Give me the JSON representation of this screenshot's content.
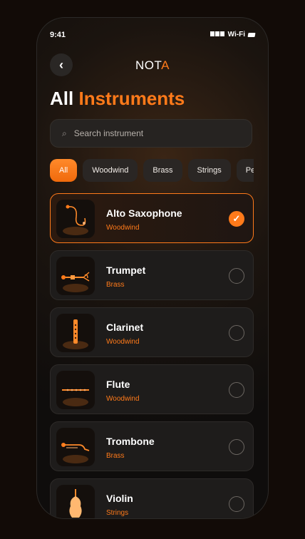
{
  "status": {
    "time": "9:41",
    "network": "Wi-Fi"
  },
  "header": {
    "logo_main": "NOT",
    "logo_accent": "A"
  },
  "page": {
    "title_white": "All",
    "title_accent": "Instruments"
  },
  "search": {
    "placeholder": "Search instrument"
  },
  "filters": [
    {
      "label": "All",
      "active": true
    },
    {
      "label": "Woodwind",
      "active": false
    },
    {
      "label": "Brass",
      "active": false
    },
    {
      "label": "Strings",
      "active": false
    },
    {
      "label": "Pe",
      "active": false
    }
  ],
  "instruments": [
    {
      "name": "Alto Saxophone",
      "category": "Woodwind",
      "selected": true,
      "icon": "saxophone-icon"
    },
    {
      "name": "Trumpet",
      "category": "Brass",
      "selected": false,
      "icon": "trumpet-icon"
    },
    {
      "name": "Clarinet",
      "category": "Woodwind",
      "selected": false,
      "icon": "clarinet-icon"
    },
    {
      "name": "Flute",
      "category": "Woodwind",
      "selected": false,
      "icon": "flute-icon"
    },
    {
      "name": "Trombone",
      "category": "Brass",
      "selected": false,
      "icon": "trombone-icon"
    },
    {
      "name": "Violin",
      "category": "Strings",
      "selected": false,
      "icon": "violin-icon"
    }
  ],
  "colors": {
    "accent": "#ff7a1a",
    "background": "#120b07",
    "card": "#1e1c1b"
  }
}
